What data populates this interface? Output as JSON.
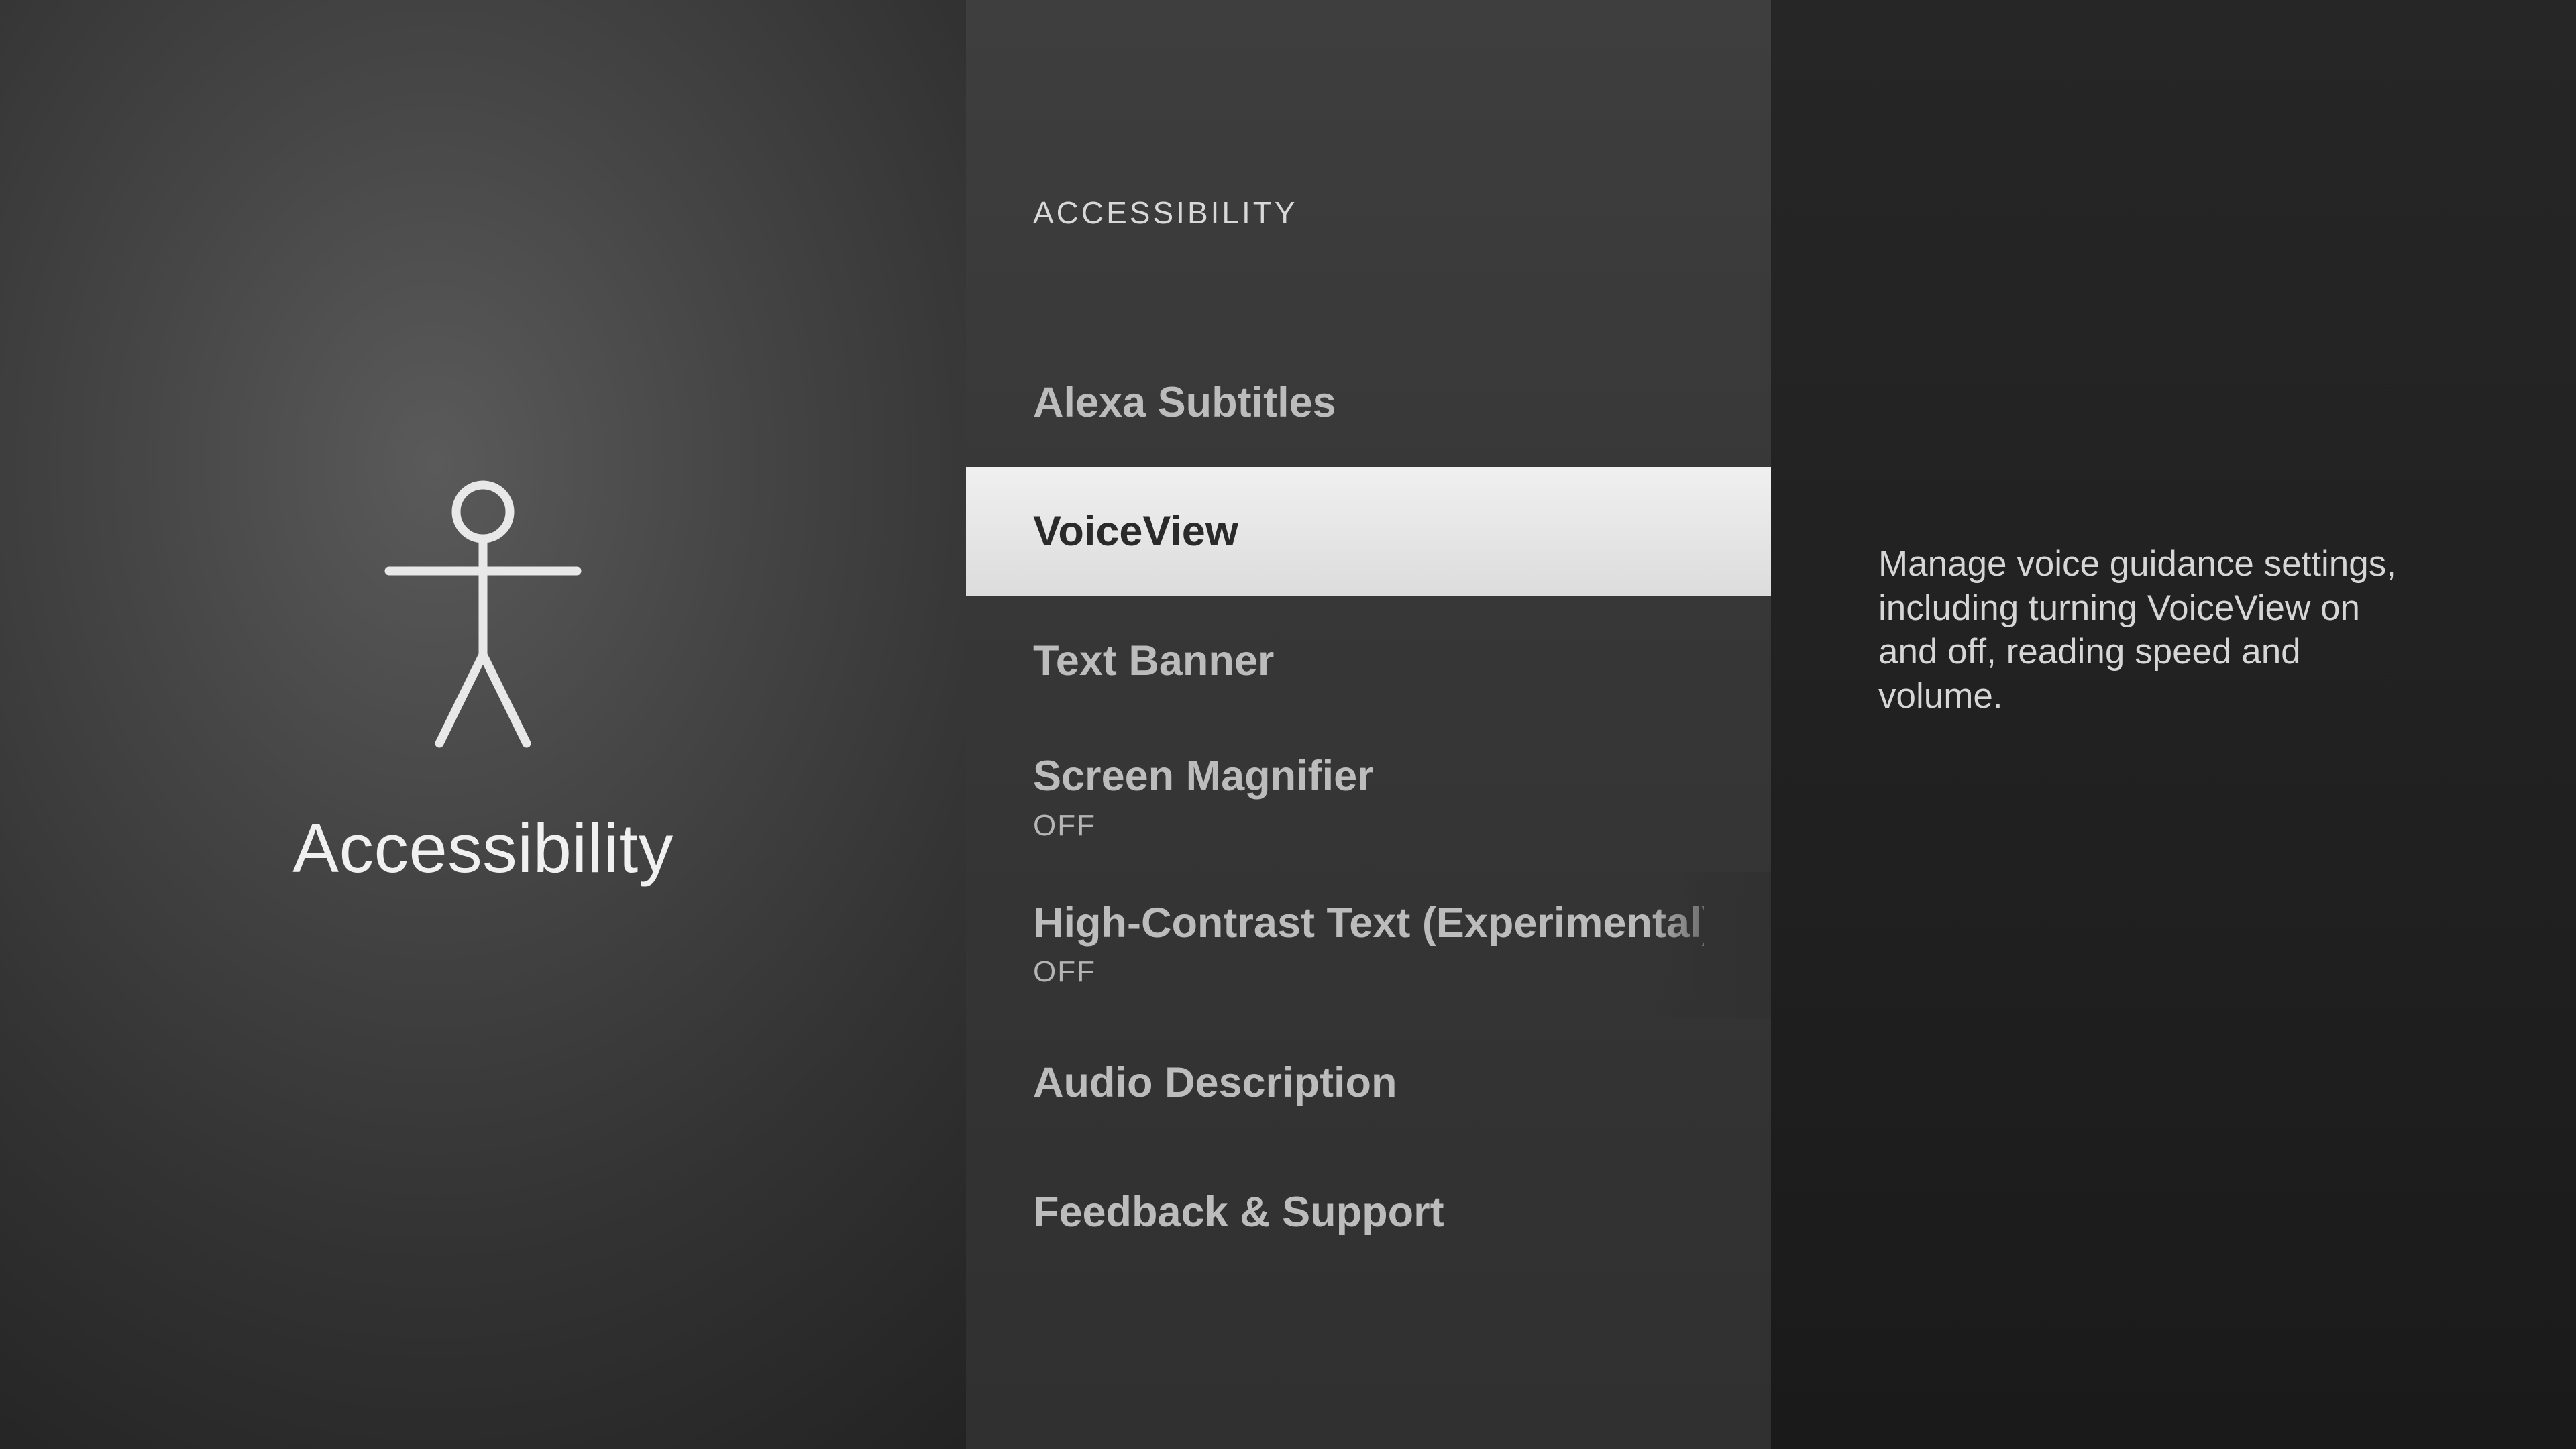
{
  "left": {
    "title": "Accessibility"
  },
  "center": {
    "header": "ACCESSIBILITY",
    "items": [
      {
        "label": "Alexa Subtitles",
        "status": null
      },
      {
        "label": "VoiceView",
        "status": null
      },
      {
        "label": "Text Banner",
        "status": null
      },
      {
        "label": "Screen Magnifier",
        "status": "OFF"
      },
      {
        "label": "High-Contrast Text (Experimental)",
        "status": "OFF"
      },
      {
        "label": "Audio Description",
        "status": null
      },
      {
        "label": "Feedback & Support",
        "status": null
      }
    ],
    "selected_index": 1
  },
  "right": {
    "description": "Manage voice guidance settings, including turning VoiceView on and off, reading speed and volume."
  }
}
